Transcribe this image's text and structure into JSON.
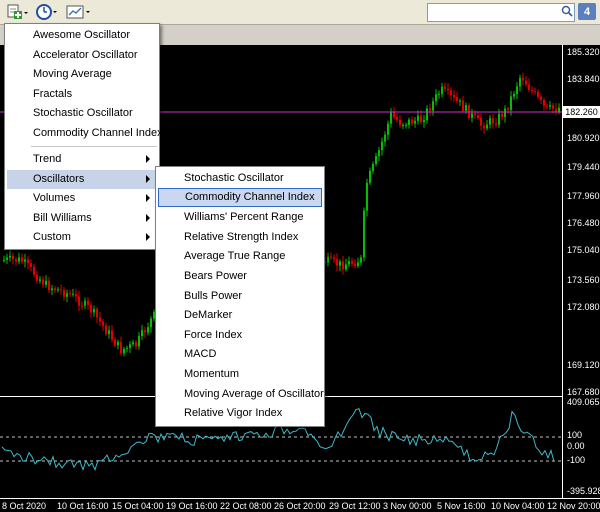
{
  "toolbar": {
    "buttons": [
      {
        "icon": "add-indicator-icon"
      },
      {
        "icon": "clock-icon"
      },
      {
        "icon": "template-icon"
      }
    ],
    "search": {
      "placeholder": "",
      "icon": "search-icon"
    },
    "badge": "4"
  },
  "price_axis": [
    "185.320",
    "183.840",
    "182.260",
    "180.920",
    "179.440",
    "177.960",
    "176.480",
    "175.040",
    "173.560",
    "172.080",
    "169.120",
    "167.680"
  ],
  "current_price": "182.260",
  "indicator_axis": [
    "409.0653",
    "100",
    "0.00",
    "-100",
    "-395.9284"
  ],
  "time_axis": [
    "8 Oct 2020",
    "10 Oct 16:00",
    "15 Oct 04:00",
    "19 Oct 16:00",
    "22 Oct 08:00",
    "26 Oct 20:00",
    "29 Oct 12:00",
    "3 Nov 00:00",
    "5 Nov 16:00",
    "10 Nov 04:00",
    "12 Nov 20:00"
  ],
  "menu": {
    "items": [
      "Awesome Oscillator",
      "Accelerator Oscillator",
      "Moving Average",
      "Fractals",
      "Stochastic Oscillator",
      "Commodity Channel Index"
    ],
    "groups": [
      "Trend",
      "Oscillators",
      "Volumes",
      "Bill Williams",
      "Custom"
    ]
  },
  "submenu": {
    "items": [
      "Stochastic Oscillator",
      "Commodity Channel Index",
      "Williams' Percent Range",
      "Relative Strength Index",
      "Average True Range",
      "Bears Power",
      "Bulls Power",
      "DeMarker",
      "Force Index",
      "MACD",
      "Momentum",
      "Moving Average of Oscillator",
      "Relative Vigor Index"
    ]
  },
  "colors": {
    "bull": "#00c000",
    "bear": "#e00000",
    "price_line": "#cc33cc",
    "cci_line": "#3fb8c8",
    "level_line": "#c0c0c0",
    "menu_highlight": "#c6d3e8"
  }
}
